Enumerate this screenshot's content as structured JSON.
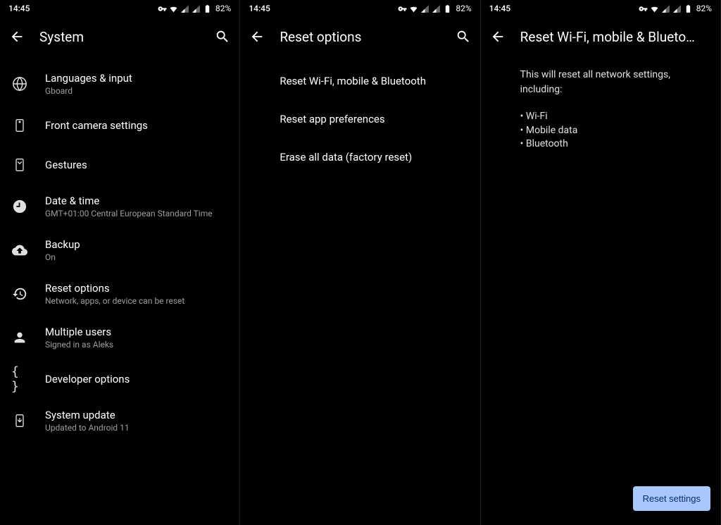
{
  "status": {
    "time": "14:45",
    "battery": "82%"
  },
  "screen1": {
    "title": "System",
    "items": [
      {
        "title": "Languages & input",
        "subtitle": "Gboard"
      },
      {
        "title": "Front camera settings",
        "subtitle": ""
      },
      {
        "title": "Gestures",
        "subtitle": ""
      },
      {
        "title": "Date & time",
        "subtitle": "GMT+01:00 Central European Standard Time"
      },
      {
        "title": "Backup",
        "subtitle": "On"
      },
      {
        "title": "Reset options",
        "subtitle": "Network, apps, or device can be reset"
      },
      {
        "title": "Multiple users",
        "subtitle": "Signed in as Aleks"
      },
      {
        "title": "Developer options",
        "subtitle": ""
      },
      {
        "title": "System update",
        "subtitle": "Updated to Android 11"
      }
    ]
  },
  "screen2": {
    "title": "Reset options",
    "items": [
      "Reset Wi-Fi, mobile & Bluetooth",
      "Reset app preferences",
      "Erase all data (factory reset)"
    ]
  },
  "screen3": {
    "title": "Reset Wi-Fi, mobile & Blueto…",
    "description": "This will reset all network settings, including:",
    "bullets": [
      "Wi-Fi",
      "Mobile data",
      "Bluetooth"
    ],
    "button": "Reset settings"
  }
}
